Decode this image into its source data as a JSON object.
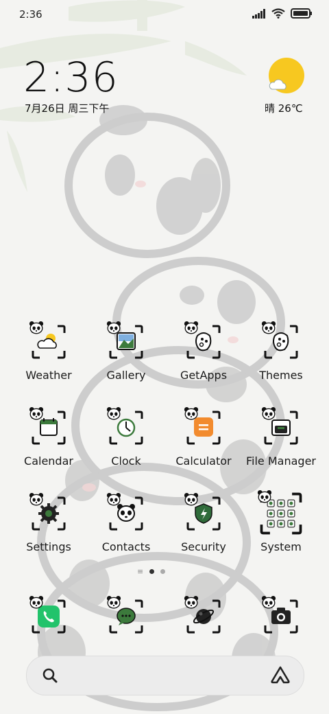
{
  "status_bar": {
    "time": "2:36"
  },
  "clock_widget": {
    "time": "2:36",
    "date": "7月26日 周三下午",
    "weather": "晴 26℃"
  },
  "apps": [
    {
      "label": "Weather",
      "icon": "weather-icon"
    },
    {
      "label": "Gallery",
      "icon": "gallery-icon"
    },
    {
      "label": "GetApps",
      "icon": "getapps-icon"
    },
    {
      "label": "Themes",
      "icon": "themes-icon"
    },
    {
      "label": "Calendar",
      "icon": "calendar-icon"
    },
    {
      "label": "Clock",
      "icon": "clock-icon"
    },
    {
      "label": "Calculator",
      "icon": "calculator-icon"
    },
    {
      "label": "File Manager",
      "icon": "file-manager-icon"
    },
    {
      "label": "Settings",
      "icon": "settings-icon"
    },
    {
      "label": "Contacts",
      "icon": "contacts-icon"
    },
    {
      "label": "Security",
      "icon": "security-icon"
    },
    {
      "label": "System",
      "icon": "system-folder-icon"
    }
  ],
  "dock": [
    {
      "icon": "phone-icon"
    },
    {
      "icon": "messages-icon"
    },
    {
      "icon": "browser-icon"
    },
    {
      "icon": "camera-icon"
    }
  ],
  "page_indicator": {
    "pages": 2,
    "current": 1
  },
  "colors": {
    "sun": "#f7c820",
    "phone": "#22c36b",
    "calculator": "#f28b2e",
    "security_shield": "#2f6b3a"
  }
}
